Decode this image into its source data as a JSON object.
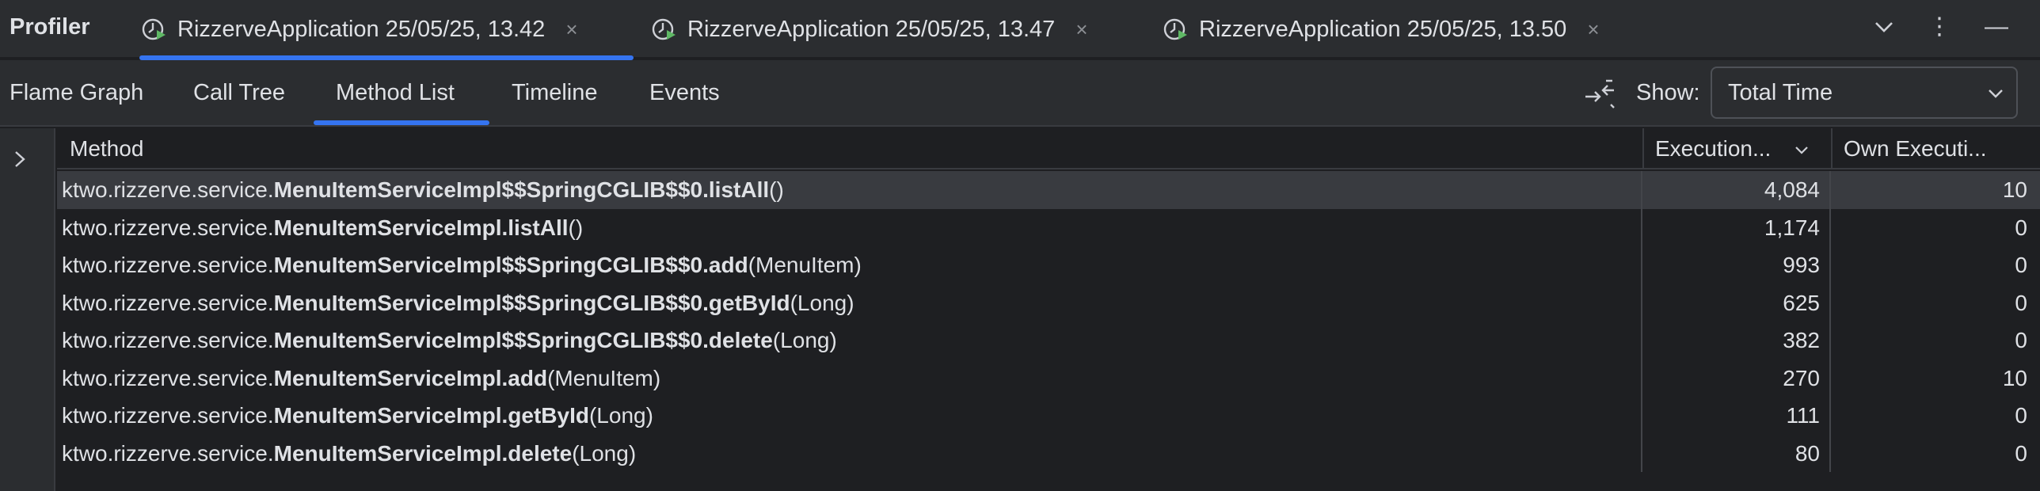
{
  "window": {
    "title": "Profiler",
    "run_tabs": [
      {
        "label": "RizzerveApplication 25/05/25, 13.42",
        "active": true
      },
      {
        "label": "RizzerveApplication 25/05/25, 13.47",
        "active": false
      },
      {
        "label": "RizzerveApplication 25/05/25, 13.50",
        "active": false
      }
    ],
    "close_glyph": "×",
    "actions": {
      "chevron": "⌄",
      "more": "⋮",
      "minimize": "—"
    }
  },
  "views": {
    "tabs": [
      {
        "label": "Flame Graph"
      },
      {
        "label": "Call Tree"
      },
      {
        "label": "Method List",
        "active": true
      },
      {
        "label": "Timeline"
      },
      {
        "label": "Events"
      }
    ],
    "show_label": "Show:",
    "show_value": "Total Time"
  },
  "table": {
    "columns": {
      "method": "Method",
      "execution": "Execution...",
      "own_execution": "Own Executi..."
    },
    "rows": [
      {
        "pkg": "ktwo.rizzerve.service.",
        "name": "MenuItemServiceImpl$$SpringCGLIB$$0.listAll",
        "args": "()",
        "execution": "4,084",
        "own": "10",
        "selected": true
      },
      {
        "pkg": "ktwo.rizzerve.service.",
        "name": "MenuItemServiceImpl.listAll",
        "args": "()",
        "execution": "1,174",
        "own": "0"
      },
      {
        "pkg": "ktwo.rizzerve.service.",
        "name": "MenuItemServiceImpl$$SpringCGLIB$$0.add",
        "args": "(MenuItem)",
        "execution": "993",
        "own": "0"
      },
      {
        "pkg": "ktwo.rizzerve.service.",
        "name": "MenuItemServiceImpl$$SpringCGLIB$$0.getById",
        "args": "(Long)",
        "execution": "625",
        "own": "0"
      },
      {
        "pkg": "ktwo.rizzerve.service.",
        "name": "MenuItemServiceImpl$$SpringCGLIB$$0.delete",
        "args": "(Long)",
        "execution": "382",
        "own": "0"
      },
      {
        "pkg": "ktwo.rizzerve.service.",
        "name": "MenuItemServiceImpl.add",
        "args": "(MenuItem)",
        "execution": "270",
        "own": "10"
      },
      {
        "pkg": "ktwo.rizzerve.service.",
        "name": "MenuItemServiceImpl.getById",
        "args": "(Long)",
        "execution": "111",
        "own": "0"
      },
      {
        "pkg": "ktwo.rizzerve.service.",
        "name": "MenuItemServiceImpl.delete",
        "args": "(Long)",
        "execution": "80",
        "own": "0"
      }
    ]
  },
  "colors": {
    "background": "#1e1f22",
    "panel": "#2b2d30",
    "accent": "#3574f0",
    "selection": "#393b40",
    "text": "#dfe1e5",
    "icon_green": "#5fb865"
  }
}
